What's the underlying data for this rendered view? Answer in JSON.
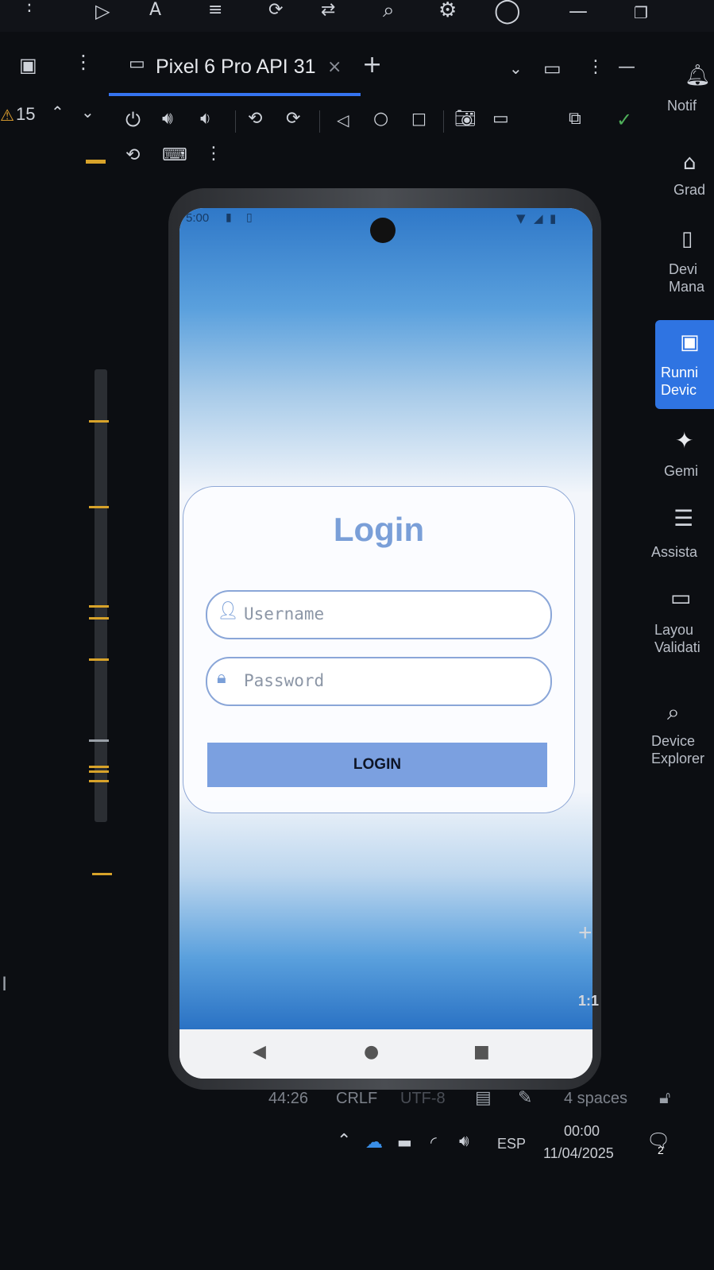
{
  "tab": {
    "title": "Pixel 6 Pro API 31",
    "close": "×",
    "add": "+"
  },
  "warnings": {
    "count": "15"
  },
  "login": {
    "status_time": "5:00",
    "title": "Login",
    "username_placeholder": "Username",
    "password_placeholder": "Password",
    "button_label": "LOGIN"
  },
  "sidebar": {
    "items": [
      {
        "label": "Notif",
        "icon": "bell-icon"
      },
      {
        "label": "Grad",
        "icon": "elephant-icon"
      },
      {
        "label": "Devi\nMana",
        "icon": "device-manager-icon"
      },
      {
        "label": "Runni\nDevic",
        "icon": "running-devices-icon",
        "active": true
      },
      {
        "label": "Gemi",
        "icon": "sparkle-icon"
      },
      {
        "label": "Assista",
        "icon": "list-icon"
      },
      {
        "label": "Layou\nValidati",
        "icon": "layout-icon"
      },
      {
        "label": "Device\nExplorer",
        "icon": "device-explorer-icon"
      }
    ]
  },
  "zoom": {
    "plus": "+",
    "ratio": "1:1"
  },
  "ide_status": {
    "position": "44:26",
    "line_sep": "CRLF",
    "encoding": "UTF-8",
    "indent": "4 spaces"
  },
  "taskbar": {
    "language": "ESP",
    "time": "00:00",
    "date": "11/04/2025",
    "notifications": "2"
  },
  "colors": {
    "accent": "#3574f0",
    "login_title": "#7a9fd8",
    "login_button": "#7ba0e0",
    "warning_tick": "#d8a32a"
  }
}
